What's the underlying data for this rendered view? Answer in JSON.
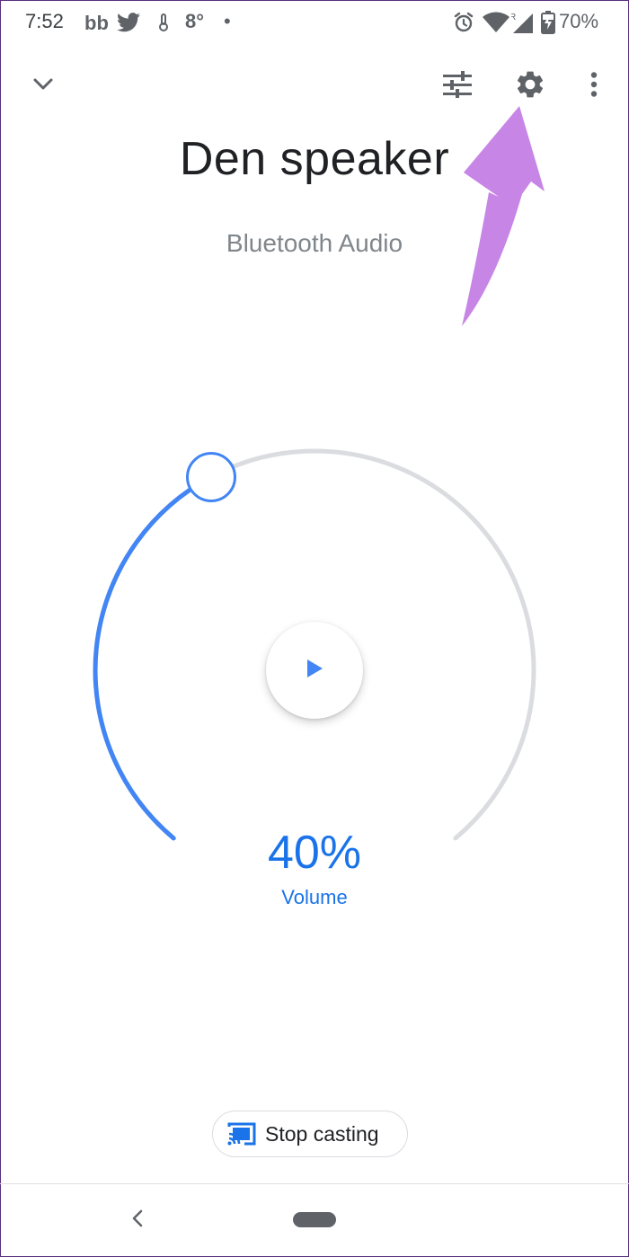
{
  "status_bar": {
    "time": "7:52",
    "app_icon_1": "bb-icon",
    "app_icon_2": "twitter-icon",
    "weather_icon": "thermometer-icon",
    "temperature": "8°",
    "dot": "•",
    "alarm_icon": "alarm-icon",
    "wifi_icon": "wifi-icon",
    "signal_icon": "signal-icon",
    "roaming_indicator": "R",
    "battery_icon": "battery-charging-icon",
    "battery_percent": "70%"
  },
  "toolbar": {
    "collapse_icon": "chevron-down-icon",
    "equalizer_icon": "equalizer-icon",
    "settings_icon": "gear-icon",
    "more_icon": "more-vert-icon"
  },
  "device": {
    "name": "Den speaker",
    "type": "Bluetooth Audio"
  },
  "volume": {
    "value_text": "40%",
    "level": 0.4,
    "label": "Volume"
  },
  "actions": {
    "stop_casting_label": "Stop casting"
  },
  "colors": {
    "accent": "#4285f4",
    "accent_text": "#1a73e8",
    "track": "#dadce0",
    "annotation_arrow": "#c785e6"
  }
}
